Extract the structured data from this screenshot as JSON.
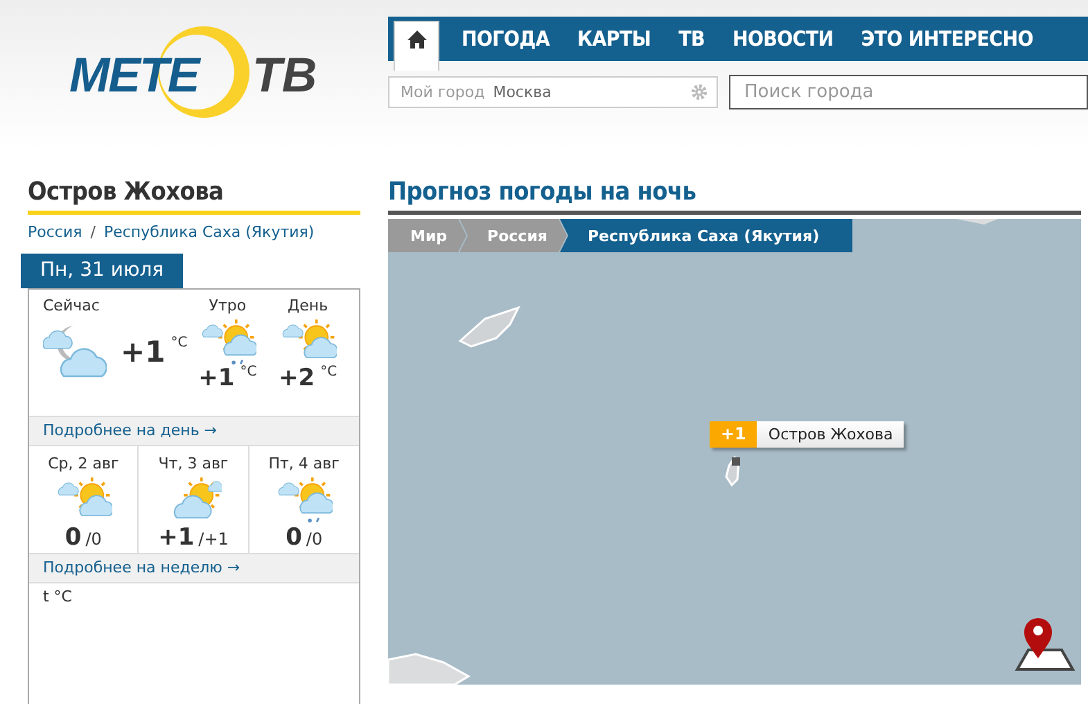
{
  "logo": {
    "left": "МЕТЕ",
    "right": "ТВ"
  },
  "tabs": [
    {
      "kind": "home",
      "selected": true
    },
    {
      "kind": "text",
      "label": "ПОГОДА",
      "selected": false
    },
    {
      "kind": "text",
      "label": "КАРТЫ",
      "selected": false
    },
    {
      "kind": "text",
      "label": "ТВ",
      "selected": false
    },
    {
      "kind": "text",
      "label": "НОВОСТИ",
      "selected": false
    },
    {
      "kind": "text",
      "label": "ЭТО ИНТЕРЕСНО",
      "selected": false
    }
  ],
  "my_city": {
    "label": "Мой город",
    "value": "Москва"
  },
  "search": {
    "placeholder": "Поиск города"
  },
  "place": {
    "title": "Остров Жохова",
    "breadcrumbs": [
      "Россия",
      "Республика Саха (Якутия)"
    ],
    "separator": "/"
  },
  "day_tab": "Пн, 31 июля",
  "now": {
    "label": "Сейчас",
    "kind": "moon-cloud",
    "temp": "+1",
    "unit": "°C"
  },
  "parts": [
    {
      "label": "Утро",
      "kind": "sun-cloud-precip",
      "temp": "+1",
      "unit": "°C"
    },
    {
      "label": "День",
      "kind": "sun-cloud",
      "temp": "+2",
      "unit": "°C"
    }
  ],
  "day_link": "Подробнее на день →",
  "days": [
    {
      "label": "Ср, 2 авг",
      "kind": "sun-cloud",
      "day": "0",
      "night": "/0"
    },
    {
      "label": "Чт, 3 авг",
      "kind": "cloud-sun",
      "day": "+1",
      "night": "/+1"
    },
    {
      "label": "Пт, 4 авг",
      "kind": "sun-cloud-precip",
      "day": "0",
      "night": "/0"
    }
  ],
  "week_link": "Подробнее на неделю →",
  "chart_label": "t °C",
  "forecast": {
    "title": "Прогноз погоды на ночь",
    "breadcrumbs": [
      {
        "label": "Мир",
        "selected": false
      },
      {
        "label": "Россия",
        "selected": false
      },
      {
        "label": "Республика Саха (Якутия)",
        "selected": true
      }
    ],
    "marker": {
      "temp": "+1",
      "name": "Остров Жохова"
    }
  }
}
